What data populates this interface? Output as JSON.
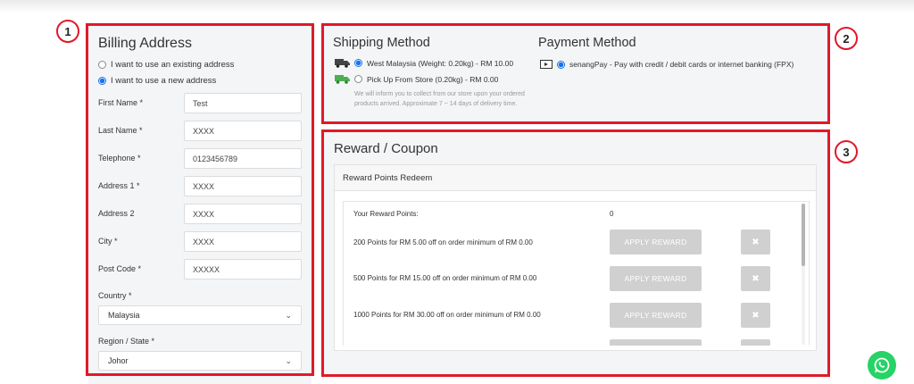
{
  "markers": [
    "1",
    "2",
    "3"
  ],
  "billing": {
    "title": "Billing Address",
    "address_options": [
      {
        "label": "I want to use an existing address",
        "selected": false
      },
      {
        "label": "I want to use a new address",
        "selected": true
      }
    ],
    "fields": [
      {
        "label": "First Name *",
        "value": "Test"
      },
      {
        "label": "Last Name *",
        "value": "XXXX"
      },
      {
        "label": "Telephone *",
        "value": "0123456789"
      },
      {
        "label": "Address 1 *",
        "value": "XXXX"
      },
      {
        "label": "Address 2",
        "value": "XXXX"
      },
      {
        "label": "City *",
        "value": "XXXX"
      },
      {
        "label": "Post Code *",
        "value": "XXXXX"
      }
    ],
    "country": {
      "label": "Country *",
      "value": "Malaysia"
    },
    "region": {
      "label": "Region / State *",
      "value": "Johor"
    }
  },
  "shipping": {
    "title": "Shipping Method",
    "options": [
      {
        "label": "West Malaysia (Weight: 0.20kg) - RM 10.00",
        "selected": true,
        "icon": "delivery-truck-icon"
      },
      {
        "label": "Pick Up From Store (0.20kg) - RM 0.00",
        "selected": false,
        "icon": "pickup-truck-icon"
      }
    ],
    "note": "We will inform you to collect from our store upon your ordered products arrived. Approximate 7 ~ 14 days of delivery time."
  },
  "payment": {
    "title": "Payment Method",
    "options": [
      {
        "label": "senangPay - Pay with credit / debit cards or internet banking (FPX)",
        "selected": true,
        "icon": "payment-card-icon"
      }
    ]
  },
  "reward": {
    "title": "Reward / Coupon",
    "panel_title": "Reward Points Redeem",
    "points_label": "Your Reward Points:",
    "points_value": "0",
    "apply_label": "APPLY REWARD",
    "cancel_glyph": "✖",
    "offers": [
      "200 Points for RM 5.00 off on order minimum of RM 0.00",
      "500 Points for RM 15.00 off on order minimum of RM 0.00",
      "1000 Points for RM 30.00 off on order minimum of RM 0.00"
    ]
  },
  "colors": {
    "accent": "#e0192a",
    "radio": "#1a73e8",
    "panel": "#f4f5f7",
    "button_disabled": "#d0d0d0",
    "whatsapp": "#25d366"
  }
}
